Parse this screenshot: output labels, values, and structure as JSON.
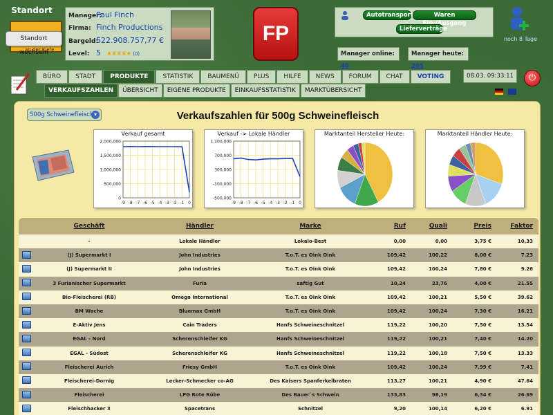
{
  "standort": {
    "title": "Standort",
    "tooltip": "Standort wechseln",
    "subtext": "an der Kiefe"
  },
  "manager": {
    "manager_label": "Manager:",
    "manager_value": "Paul Finch",
    "firma_label": "Firma:",
    "firma_value": "Finch Productions",
    "bargeld_label": "Bargeld:",
    "bargeld_value": "522.908.757,77 €",
    "level_label": "Level:",
    "level_value": "5",
    "stars": "★★★★★",
    "stars_extra": "(0)"
  },
  "logo": {
    "text": "FP"
  },
  "links": {
    "autotransporte": "Autotransporte",
    "waren": "Waren Ein-/Ausgang",
    "vertraege": "Lieferverträge"
  },
  "stats": {
    "online_label": "Manager online:",
    "online_value": "40",
    "heute_label": "Manager heute:",
    "heute_value": "265"
  },
  "newuser": {
    "label": "noch 8 Tage"
  },
  "nav": {
    "tabs": [
      "BÜRO",
      "STADT",
      "PRODUKTE",
      "STATISTIK",
      "BAUMENÜ",
      "PLUS",
      "HILFE",
      "NEWS",
      "FORUM",
      "CHAT",
      "VOTING"
    ]
  },
  "subnav": {
    "tabs": [
      "VERKAUFSZAHLEN",
      "ÜBERSICHT",
      "EIGENE PRODUKTE",
      "EINKAUFSSTATISTIK",
      "MARKTÜBERSICHT"
    ]
  },
  "clock": {
    "value": "08.03. 09:33:11"
  },
  "product_select": {
    "value": "500g Schweinefleisch"
  },
  "page_title": "Verkaufszahlen für 500g Schweinefleisch",
  "chart_data": [
    {
      "type": "line",
      "title": "Verkauf gesamt",
      "x": [
        "-9",
        "-8",
        "-7",
        "-6",
        "-5",
        "-4",
        "-3",
        "-2",
        "-1",
        "0"
      ],
      "values": [
        1800000,
        1810000,
        1805000,
        1810000,
        1808000,
        1806000,
        1805000,
        1804000,
        1800000,
        200000
      ],
      "ylim": [
        0,
        2000000
      ],
      "yticks": [
        "2,000,000",
        "1,500,000",
        "1,000,000",
        "500,000",
        "0"
      ],
      "grid": true
    },
    {
      "type": "line",
      "title": "Verkauf -> Lokale Händler",
      "x": [
        "-9",
        "-8",
        "-7",
        "-6",
        "-5",
        "-4",
        "-3",
        "-2",
        "-1",
        "0"
      ],
      "values": [
        600000,
        620000,
        580000,
        570000,
        590000,
        600000,
        600000,
        610000,
        610000,
        100000
      ],
      "ylim": [
        -500000,
        1100000
      ],
      "yticks": [
        "1,100,000",
        "700,000",
        "300,000",
        "-100,000",
        "-500,000"
      ],
      "grid": true
    },
    {
      "type": "pie",
      "title": "Marktanteil Hersteller Heute:",
      "values": [
        42,
        14,
        12,
        9,
        7,
        5,
        4,
        3,
        2,
        2
      ],
      "colors": [
        "#f0c040",
        "#3fa84a",
        "#5aa0c8",
        "#d1d1d1",
        "#3b7d45",
        "#d6b040",
        "#8a50c8",
        "#4060a0",
        "#c84040",
        "#e0e060"
      ]
    },
    {
      "type": "pie",
      "title": "Marktanteil Händler Heute:",
      "values": [
        30,
        14,
        12,
        10,
        8,
        6,
        5,
        5,
        4,
        3,
        3
      ],
      "colors": [
        "#f0c040",
        "#a8d0f0",
        "#c8c8c8",
        "#66cc66",
        "#8a50c8",
        "#e0e060",
        "#4060a0",
        "#c84040",
        "#9ac09a",
        "#7090b0",
        "#d0a060"
      ]
    }
  ],
  "table": {
    "headers": {
      "geschaeft": "Geschäft",
      "haendler": "Händler",
      "marke": "Marke",
      "ruf": "Ruf",
      "quali": "Quali",
      "preis": "Preis",
      "faktor": "Faktor"
    },
    "rows": [
      {
        "geschaeft": "-",
        "haendler": "Lokale Händler",
        "marke": "Lokalo-Best",
        "ruf": "0,00",
        "quali": "0,00",
        "preis": "3,75 €",
        "faktor": "10,33"
      },
      {
        "geschaeft": "(J) Supermarkt I",
        "haendler": "John Industries",
        "marke": "T.o.T. es Oink Oink",
        "ruf": "109,42",
        "quali": "100,22",
        "preis": "8,00 €",
        "faktor": "7.23"
      },
      {
        "geschaeft": "(J) Supermarkt II",
        "haendler": "John Industries",
        "marke": "T.o.T. es Oink Oink",
        "ruf": "109,42",
        "quali": "100,24",
        "preis": "7,80 €",
        "faktor": "9.26"
      },
      {
        "geschaeft": "3 Furianischer Supermarkt",
        "haendler": "Furia",
        "marke": "saftig Gut",
        "ruf": "10,24",
        "quali": "23,76",
        "preis": "4,00 €",
        "faktor": "21.55"
      },
      {
        "geschaeft": "Bio-Fleischerei (RB)",
        "haendler": "Omega International",
        "marke": "T.o.T. es Oink Oink",
        "ruf": "109,42",
        "quali": "100,21",
        "preis": "5,50 €",
        "faktor": "39.62"
      },
      {
        "geschaeft": "BM Wache",
        "haendler": "Bluemax GmbH",
        "marke": "T.o.T. es Oink Oink",
        "ruf": "109,42",
        "quali": "100,24",
        "preis": "7,30 €",
        "faktor": "16.21"
      },
      {
        "geschaeft": "E-Aktiv Jens",
        "haendler": "Cain Traders",
        "marke": "Hanfs Schweineschnitzel",
        "ruf": "119,22",
        "quali": "100,20",
        "preis": "7,50 €",
        "faktor": "13.54"
      },
      {
        "geschaeft": "EGAL - Nord",
        "haendler": "Scherenschleifer KG",
        "marke": "Hanfs Schweineschnitzel",
        "ruf": "119,22",
        "quali": "100,21",
        "preis": "7,40 €",
        "faktor": "14.20"
      },
      {
        "geschaeft": "EGAL - Südost",
        "haendler": "Scherenschleifer KG",
        "marke": "Hanfs Schweineschnitzel",
        "ruf": "119,22",
        "quali": "100,18",
        "preis": "7,50 €",
        "faktor": "13.33"
      },
      {
        "geschaeft": "Fleischerei Aurich",
        "haendler": "Friesy GmbH",
        "marke": "T.o.T. es Oink Oink",
        "ruf": "109,42",
        "quali": "100,24",
        "preis": "7,99 €",
        "faktor": "7.41"
      },
      {
        "geschaeft": "Fleischerei-Dornig",
        "haendler": "Lecker-Schmecker co-AG",
        "marke": "Des Kaisers Spanferkelbraten",
        "ruf": "113,27",
        "quali": "100,21",
        "preis": "4,90 €",
        "faktor": "47.64"
      },
      {
        "geschaeft": "Fleischerei",
        "haendler": "LPG Rote Rübe",
        "marke": "Des Bauer`s Schwein",
        "ruf": "133,83",
        "quali": "98,19",
        "preis": "6,34 €",
        "faktor": "26.69"
      },
      {
        "geschaeft": "Fleischhacker 3",
        "haendler": "Spacetrans",
        "marke": "Schnitzel",
        "ruf": "9,20",
        "quali": "100,14",
        "preis": "6,20 €",
        "faktor": "6.91"
      }
    ]
  }
}
